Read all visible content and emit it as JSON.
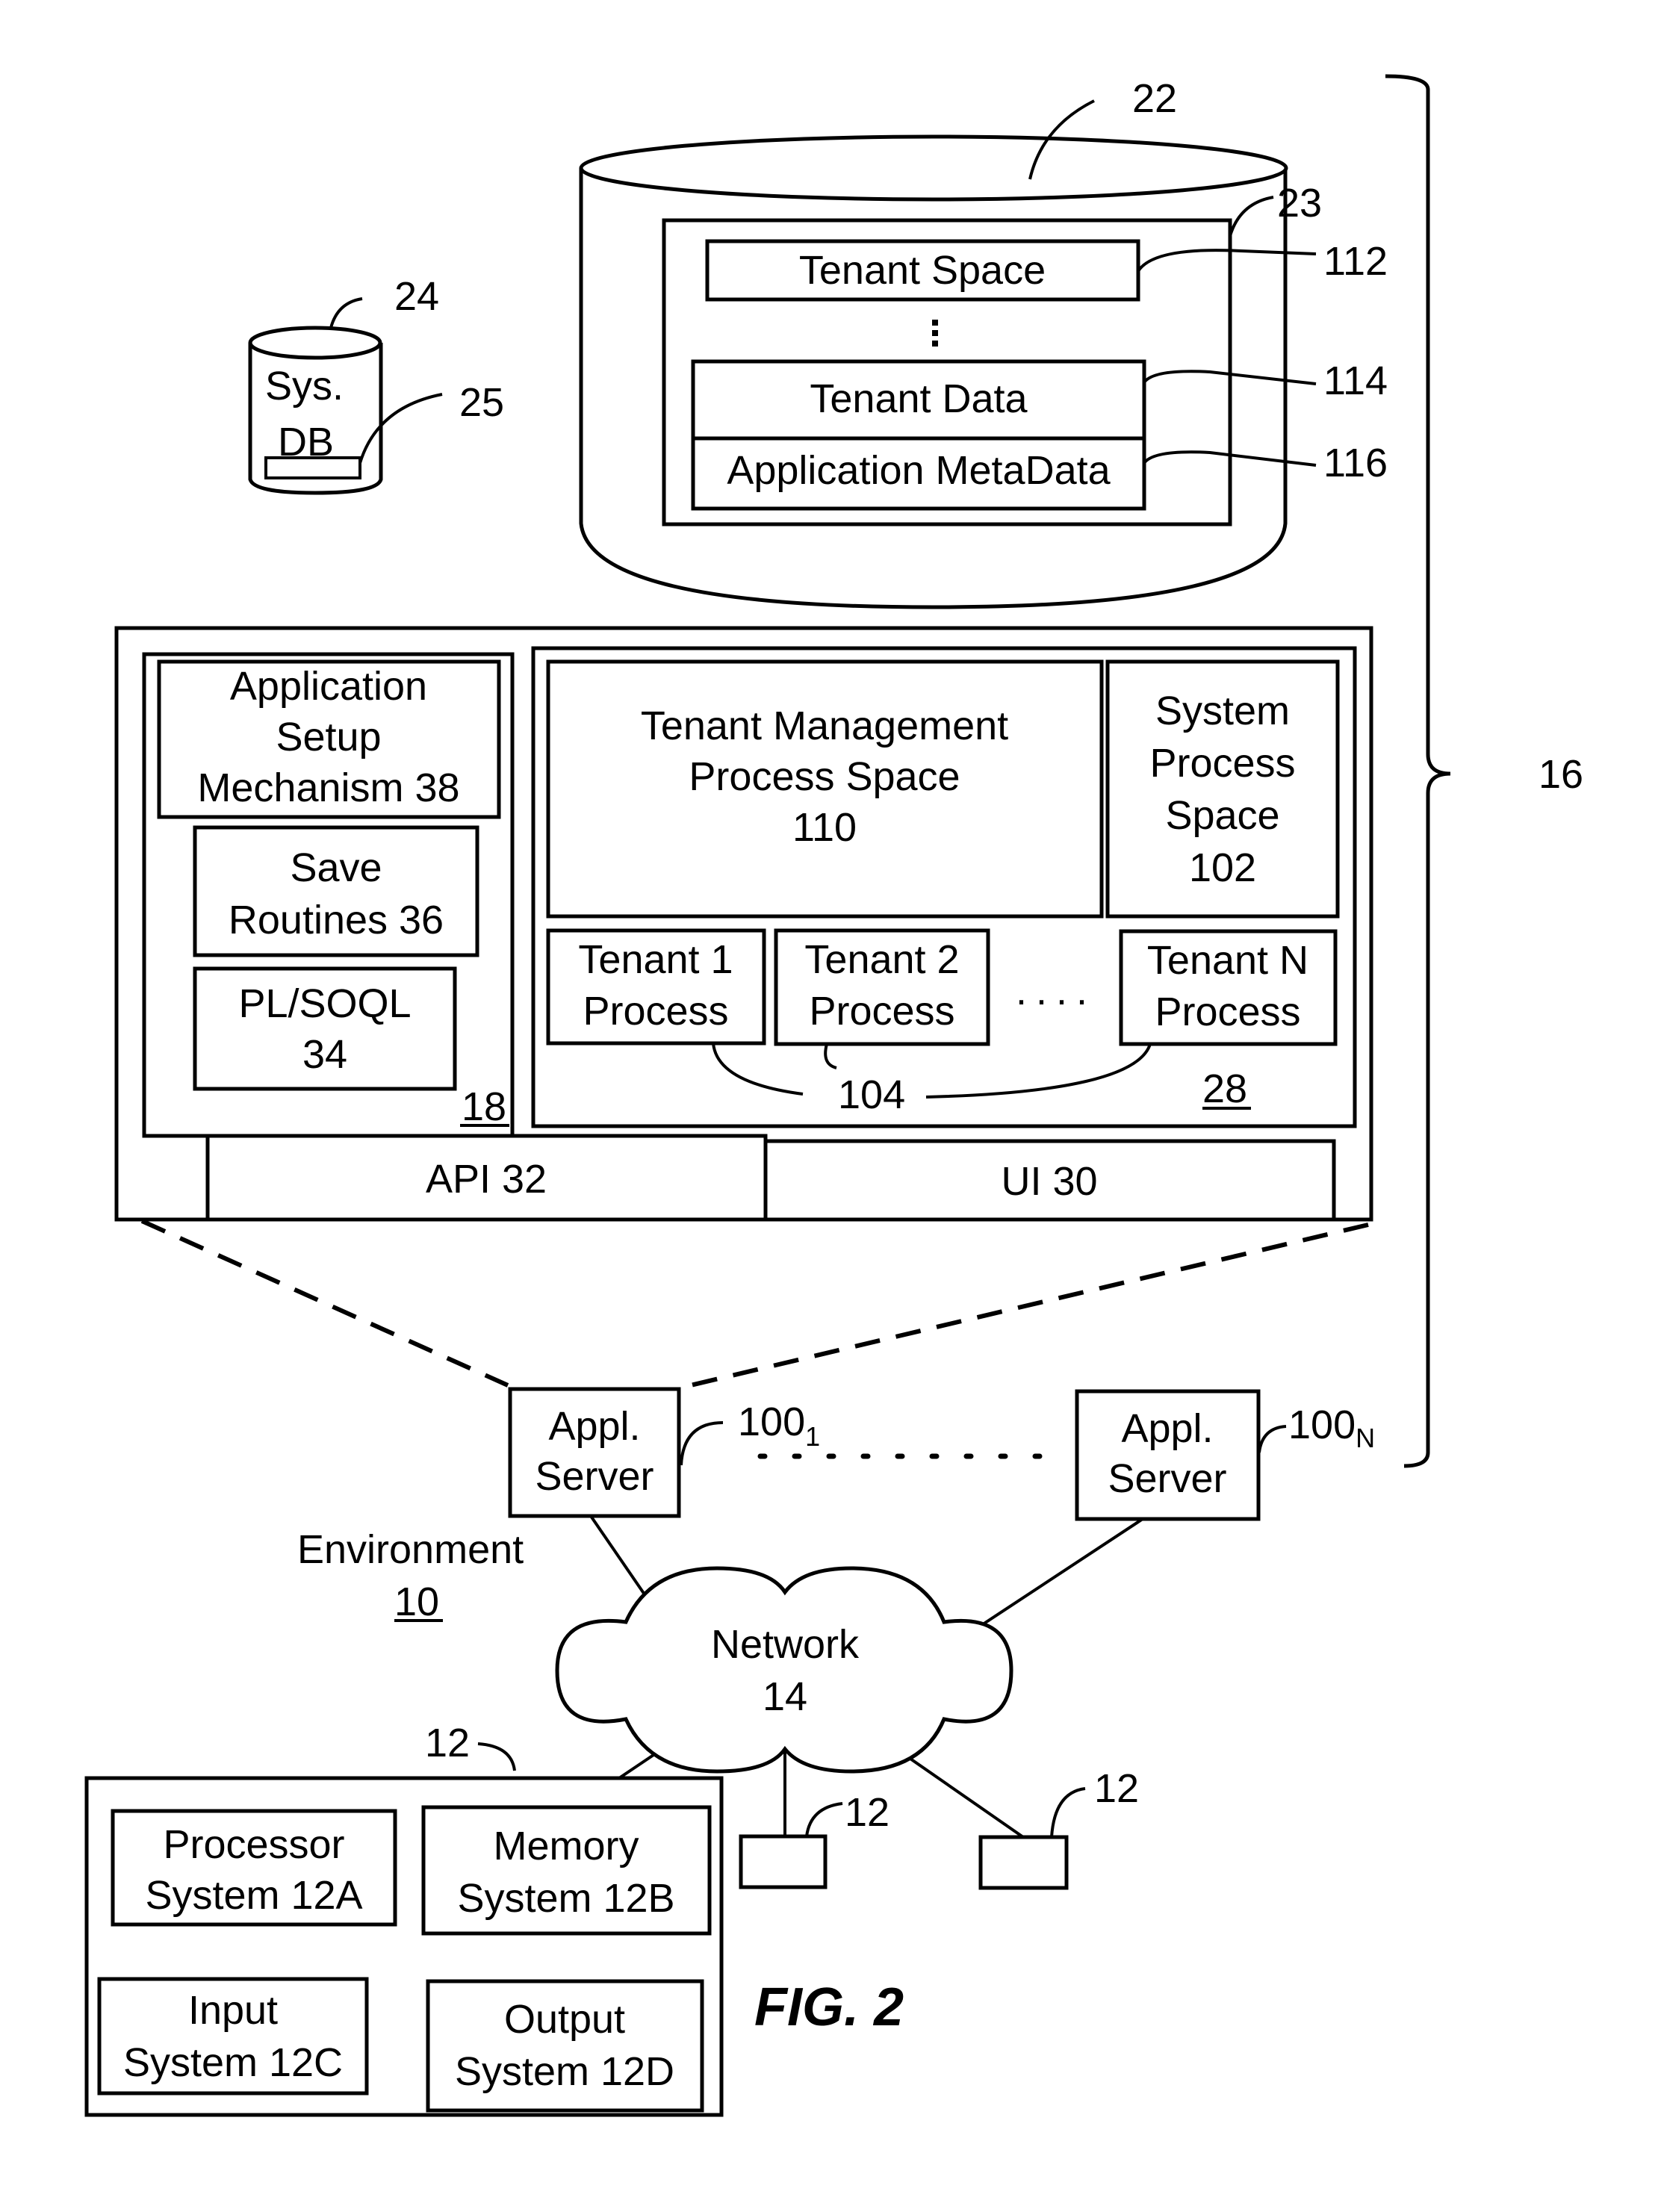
{
  "figure_label": "FIG. 2",
  "database_22": {
    "ref": "22",
    "container_ref": "23",
    "tenant_space": {
      "label": "Tenant Space",
      "ref": "112"
    },
    "tenant_data": {
      "label": "Tenant Data",
      "ref": "114"
    },
    "app_metadata": {
      "label": "Application MetaData",
      "ref": "116"
    }
  },
  "system_db": {
    "ref": "24",
    "label_line1": "Sys.",
    "label_line2": "DB",
    "inner_ref": "25"
  },
  "server_detail": {
    "left_panel_ref": "18",
    "app_setup": {
      "line1": "Application",
      "line2": "Setup",
      "line3": "Mechanism 38"
    },
    "save_routines": {
      "line1": "Save",
      "line2": "Routines 36"
    },
    "plsoql": {
      "line1": "PL/SOQL",
      "line2": "34"
    },
    "process_space_ref": "28",
    "tenant_mgmt": {
      "line1": "Tenant Management",
      "line2": "Process Space",
      "line3": "110"
    },
    "system_process": {
      "line1": "System",
      "line2": "Process",
      "line3": "Space",
      "line4": "102"
    },
    "tenant1": {
      "line1": "Tenant 1",
      "line2": "Process"
    },
    "tenant2": {
      "line1": "Tenant 2",
      "line2": "Process"
    },
    "tenantN": {
      "line1": "Tenant N",
      "line2": "Process"
    },
    "ellipsis": "....",
    "tenant_process_ref": "104",
    "api": "API 32",
    "ui": "UI 30"
  },
  "system_ref": "16",
  "app_servers": [
    {
      "line1": "Appl.",
      "line2": "Server",
      "ref_base": "100",
      "ref_sub": "1"
    },
    {
      "line1": "Appl.",
      "line2": "Server",
      "ref_base": "100",
      "ref_sub": "N"
    }
  ],
  "environment": {
    "label": "Environment",
    "ref": "10"
  },
  "network": {
    "line1": "Network",
    "line2": "14"
  },
  "user_system": {
    "ref": "12",
    "processor": {
      "line1": "Processor",
      "line2": "System 12A"
    },
    "memory": {
      "line1": "Memory",
      "line2": "System 12B"
    },
    "input": {
      "line1": "Input",
      "line2": "System 12C"
    },
    "output": {
      "line1": "Output",
      "line2": "System 12D"
    }
  },
  "other_user_systems": [
    {
      "ref": "12"
    },
    {
      "ref": "12"
    }
  ]
}
